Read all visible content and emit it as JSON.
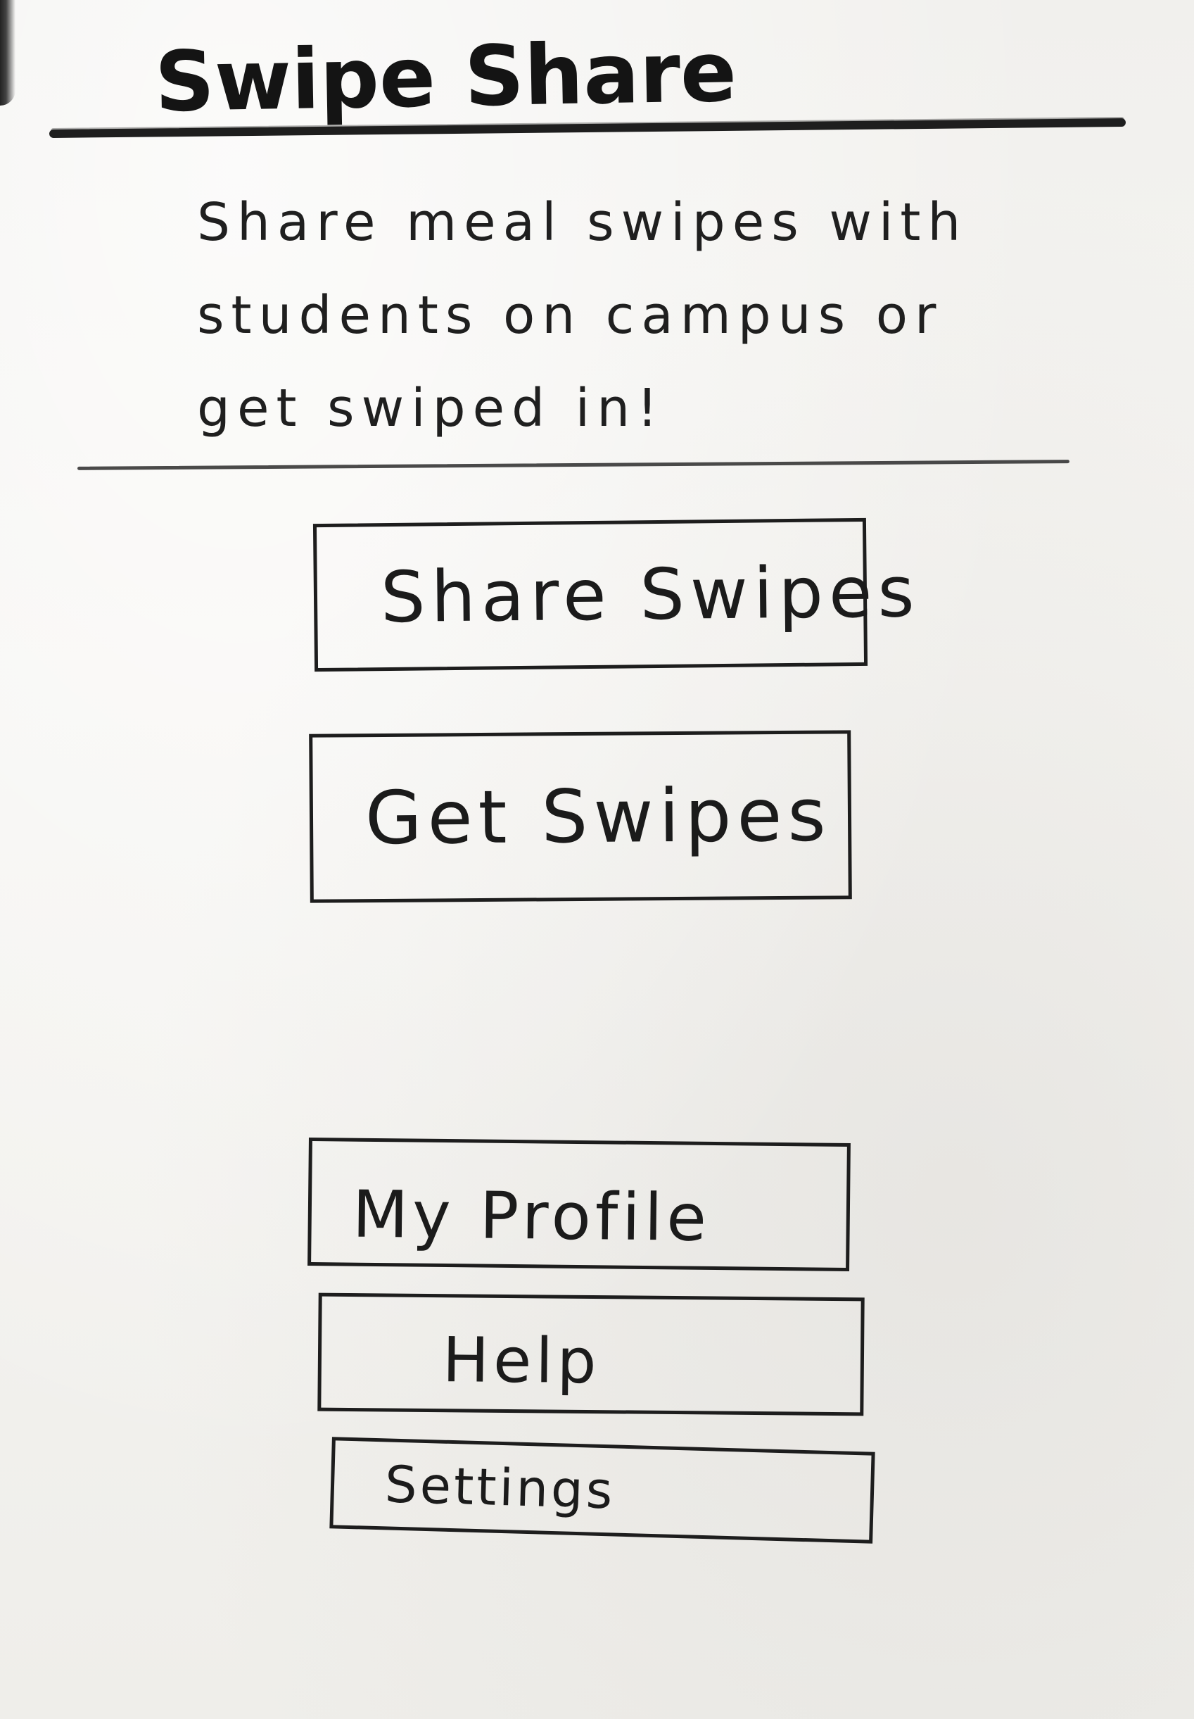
{
  "header": {
    "title": "Swipe Share"
  },
  "intro": {
    "tagline": "Share meal swipes with\nstudents on campus or\nget swiped in!"
  },
  "actions": {
    "share_label": "Share Swipes",
    "get_label": "Get Swipes"
  },
  "menu": {
    "profile_label": "My Profile",
    "help_label": "Help",
    "settings_label": "Settings"
  },
  "colors": {
    "paper": "#f3f2ef",
    "ink": "#1d1d1d"
  }
}
